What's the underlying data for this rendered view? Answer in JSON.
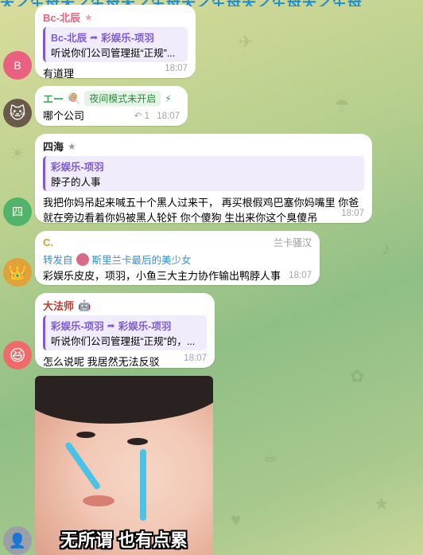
{
  "top_banner": "天之生母天之生母天之生母天之生母天之生母天之生母",
  "messages": [
    {
      "avatar_letter": "B",
      "avatar_color": "#e9617f",
      "sender": "Bc-北辰",
      "sender_color": "#e9617f",
      "reply_name": "Bc-北辰",
      "reply_arrow_target": "彩娱乐-项羽",
      "reply_text": "听说你们公司管理挺“正规”...",
      "text": "有道理",
      "time": "18:07"
    },
    {
      "sender": "エー",
      "sender_color": "#36a84f",
      "badge": "夜间模式未开启",
      "text": "哪个公司",
      "reply_count": "1",
      "time": "18:07"
    },
    {
      "sender": "四海",
      "sender_color": "#222222",
      "reply_name": "彩娱乐-项羽",
      "reply_text": "脖子的人事",
      "text": "我把你妈吊起来喊五十个黑人过来干， 再买根假鸡巴塞你妈嘴里 你爸就在旁边看着你妈被黑人轮奸 你个傻狗 生出来你这个臭傻吊",
      "avatar_letter": "四",
      "avatar_color": "#52b36a",
      "time": "18:07"
    },
    {
      "sender": "C.",
      "sender_color": "#e09a2c",
      "sender_tag": "兰卡骚汉",
      "forward_prefix": "转发自",
      "forward_from": "斯里兰卡最后的美少女",
      "text": "彩娱乐皮皮，项羽，小鱼三大主力协作输出鸭脖人事",
      "time": "18:07"
    },
    {
      "sender": "大法师",
      "sender_color": "#c0392b",
      "reply_name": "彩娱乐-项羽",
      "reply_arrow_target": "彩娱乐-项羽",
      "reply_text": "听说你们公司管理挺“正规”的，...",
      "text": "怎么说呢 我居然无法反驳",
      "time": "18:07"
    }
  ],
  "sticker": {
    "caption": "无所谓 也有点累"
  }
}
